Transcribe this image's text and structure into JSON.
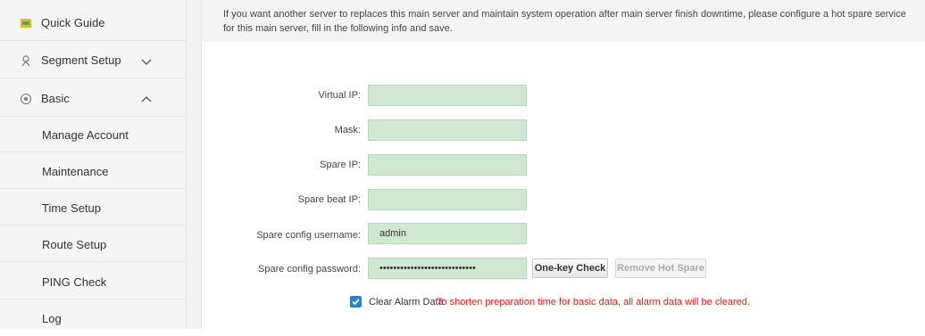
{
  "sidebar": {
    "items": [
      {
        "label": "Quick Guide",
        "icon": "quick-guide-icon"
      },
      {
        "label": "Segment Setup",
        "icon": "segment-setup-icon",
        "expanded": false
      },
      {
        "label": "Basic",
        "icon": "basic-settings-icon",
        "expanded": true
      }
    ],
    "subitems": [
      {
        "label": "Manage Account"
      },
      {
        "label": "Maintenance"
      },
      {
        "label": "Time Setup"
      },
      {
        "label": "Route Setup"
      },
      {
        "label": "PING Check"
      },
      {
        "label": "Log"
      }
    ]
  },
  "info": {
    "text": "If you want another server to replaces this main server and maintain system operation after main server finish downtime, please configure a hot spare service for this main server, fill in the following info and save."
  },
  "form": {
    "virtual_ip": {
      "label": "Virtual IP:",
      "value": ""
    },
    "mask": {
      "label": "Mask:",
      "value": ""
    },
    "spare_ip": {
      "label": "Spare IP:",
      "value": ""
    },
    "spare_beat_ip": {
      "label": "Spare beat IP:",
      "value": ""
    },
    "spare_username": {
      "label": "Spare config username:",
      "value": "admin"
    },
    "spare_password": {
      "label": "Spare config password:",
      "value": "••••••••••••••••••••••••••••"
    }
  },
  "buttons": {
    "one_key_check": "One-key Check",
    "remove_hot_spare": "Remove Hot Spare"
  },
  "clear_alarm": {
    "checked": true,
    "label": "Clear Alarm Data",
    "note": "To shorten preparation time for basic data, all alarm data will be cleared."
  },
  "colors": {
    "input_bg": "#cfe9d0",
    "checkbox": "#2f7fc9",
    "warning_text": "#e02020",
    "quick_guide_icon": "#e0b020"
  }
}
